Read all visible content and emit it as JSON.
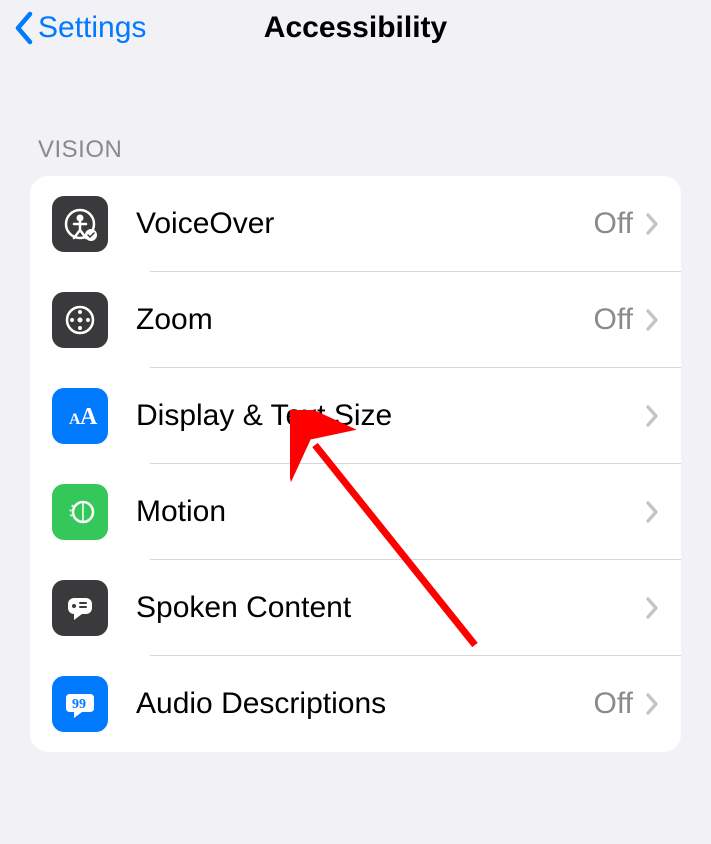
{
  "header": {
    "back_label": "Settings",
    "title": "Accessibility"
  },
  "section": {
    "label": "VISION"
  },
  "status": {
    "off": "Off"
  },
  "items": [
    {
      "label": "VoiceOver",
      "status": "Off"
    },
    {
      "label": "Zoom",
      "status": "Off"
    },
    {
      "label": "Display & Text Size",
      "status": ""
    },
    {
      "label": "Motion",
      "status": ""
    },
    {
      "label": "Spoken Content",
      "status": ""
    },
    {
      "label": "Audio Descriptions",
      "status": "Off"
    }
  ]
}
